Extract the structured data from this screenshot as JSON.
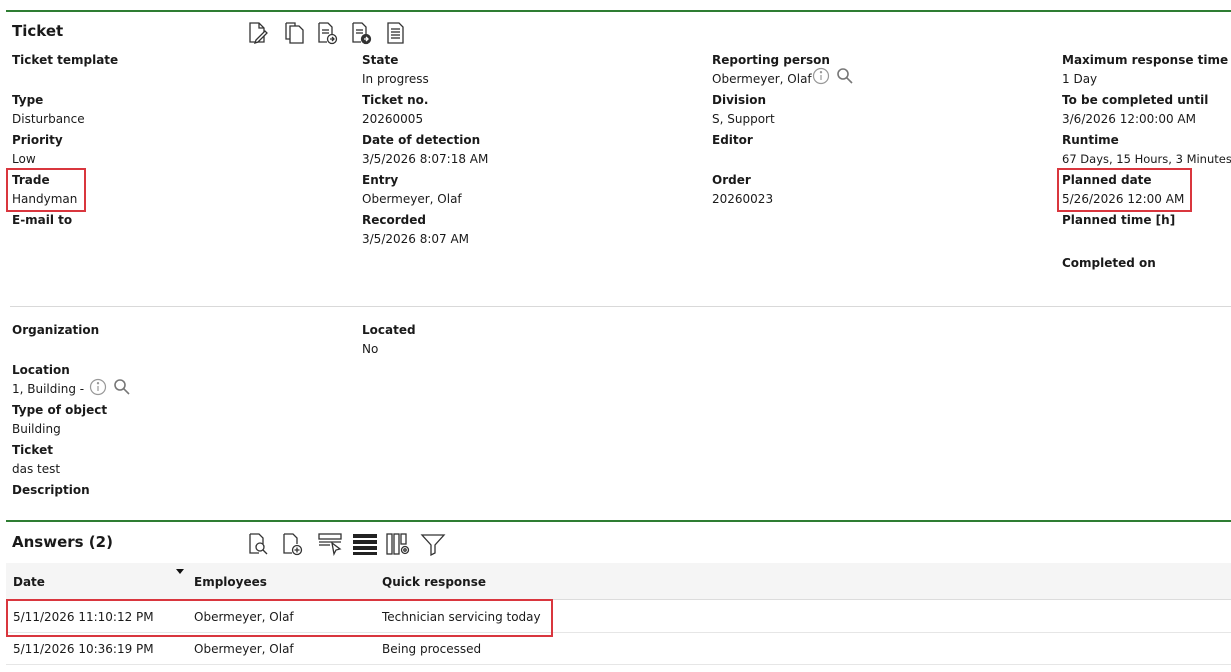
{
  "ticket": {
    "title": "Ticket",
    "toolbar": {
      "edit_icon": "edit-document-icon",
      "copy_icon": "copy-document-icon",
      "forward1_icon": "document-forward-icon",
      "forward2_icon": "document-forward-alt-icon",
      "report_icon": "document-text-icon"
    },
    "col1": [
      {
        "label": "Ticket template",
        "value": ""
      },
      {
        "label": "Type",
        "value": "Disturbance"
      },
      {
        "label": "Priority",
        "value": "Low"
      },
      {
        "label": "Trade",
        "value": "Handyman"
      },
      {
        "label": "E-mail to",
        "value": ""
      }
    ],
    "col2": [
      {
        "label": "State",
        "value": "In progress"
      },
      {
        "label": "Ticket no.",
        "value": "20260005"
      },
      {
        "label": "Date of detection",
        "value": "3/5/2026 8:07:18 AM"
      },
      {
        "label": "Entry",
        "value": "Obermeyer, Olaf"
      },
      {
        "label": "Recorded",
        "value": "3/5/2026 8:07 AM"
      }
    ],
    "col3": [
      {
        "label": "Reporting person",
        "value": "Obermeyer, Olaf"
      },
      {
        "label": "Division",
        "value": "S, Support"
      },
      {
        "label": "Editor",
        "value": ""
      },
      {
        "label": "Order",
        "value": "20260023"
      }
    ],
    "col4": [
      {
        "label": "Maximum response time",
        "value": "1 Day"
      },
      {
        "label": "To be completed until",
        "value": "3/6/2026 12:00:00 AM"
      },
      {
        "label": "Runtime",
        "value": "67 Days, 15 Hours, 3 Minutes"
      },
      {
        "label": "Planned date",
        "value": "5/26/2026 12:00 AM"
      },
      {
        "label": "Planned time [h]",
        "value": ""
      },
      {
        "label": "Completed on",
        "value": ""
      }
    ]
  },
  "location": {
    "col1": [
      {
        "label": "Organization",
        "value": ""
      },
      {
        "label": "Location",
        "value": "1, Building -"
      },
      {
        "label": "Type of object",
        "value": "Building"
      },
      {
        "label": "Ticket",
        "value": "das test"
      },
      {
        "label": "Description",
        "value": ""
      }
    ],
    "col2": [
      {
        "label": "Located",
        "value": "No"
      }
    ]
  },
  "answers": {
    "title": "Answers (2)",
    "columns": [
      "Date",
      "Employees",
      "Quick response"
    ],
    "rows": [
      {
        "date": "5/11/2026 11:10:12 PM",
        "employee": "Obermeyer, Olaf",
        "response": "Technician servicing today"
      },
      {
        "date": "5/11/2026 10:36:19 PM",
        "employee": "Obermeyer, Olaf",
        "response": "Being processed"
      }
    ]
  },
  "colors": {
    "accent_line": "#2e7d32",
    "highlight": "#d9363e"
  }
}
